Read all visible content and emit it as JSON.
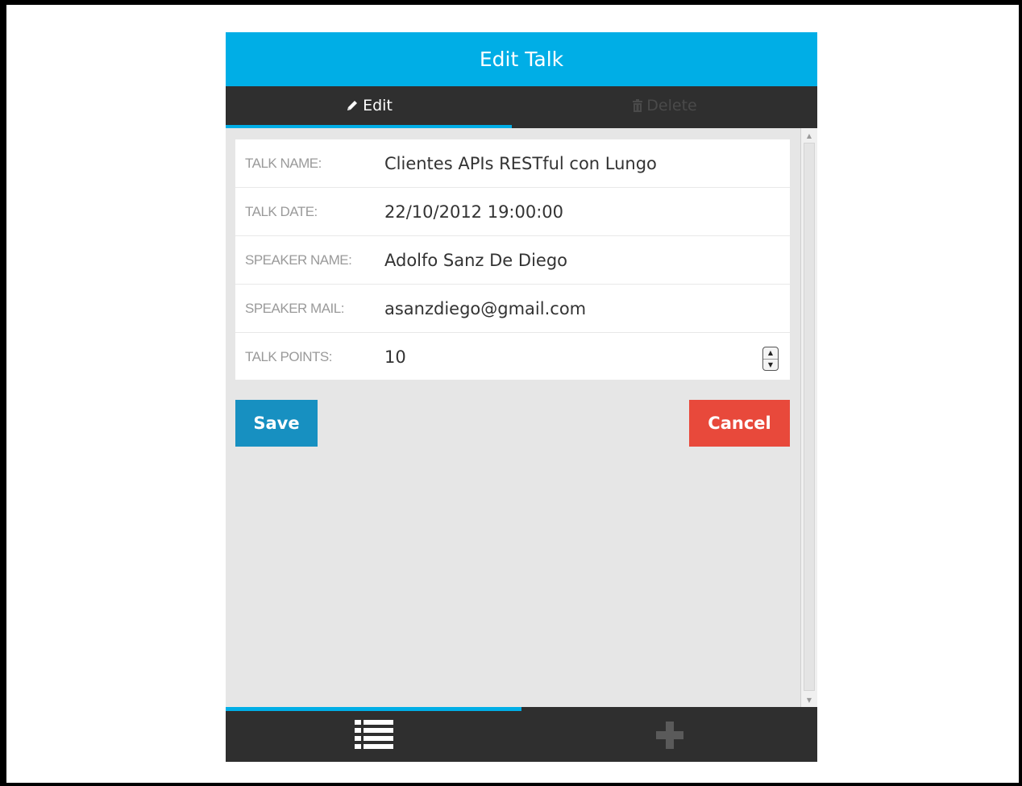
{
  "header": {
    "title": "Edit Talk"
  },
  "tabs": [
    {
      "label": "Edit",
      "icon": "pencil-icon",
      "active": true
    },
    {
      "label": "Delete",
      "icon": "trash-icon",
      "active": false
    }
  ],
  "form": {
    "fields": [
      {
        "label": "TALK NAME:",
        "value": "Clientes APIs RESTful con Lungo"
      },
      {
        "label": "TALK DATE:",
        "value": "22/10/2012 19:00:00"
      },
      {
        "label": "SPEAKER NAME:",
        "value": "Adolfo Sanz De Diego"
      },
      {
        "label": "SPEAKER MAIL:",
        "value": "asanzdiego@gmail.com"
      },
      {
        "label": "TALK POINTS:",
        "value": "10"
      }
    ]
  },
  "actions": {
    "save_label": "Save",
    "cancel_label": "Cancel"
  },
  "bottom_nav": [
    {
      "icon": "list-icon",
      "active": true
    },
    {
      "icon": "plus-icon",
      "active": false
    }
  ],
  "colors": {
    "accent": "#00aee6",
    "header_bg": "#00aee6",
    "bar_bg": "#2f2f2f",
    "save": "#1790c1",
    "cancel": "#e8493b",
    "content_bg": "#e6e6e6"
  }
}
